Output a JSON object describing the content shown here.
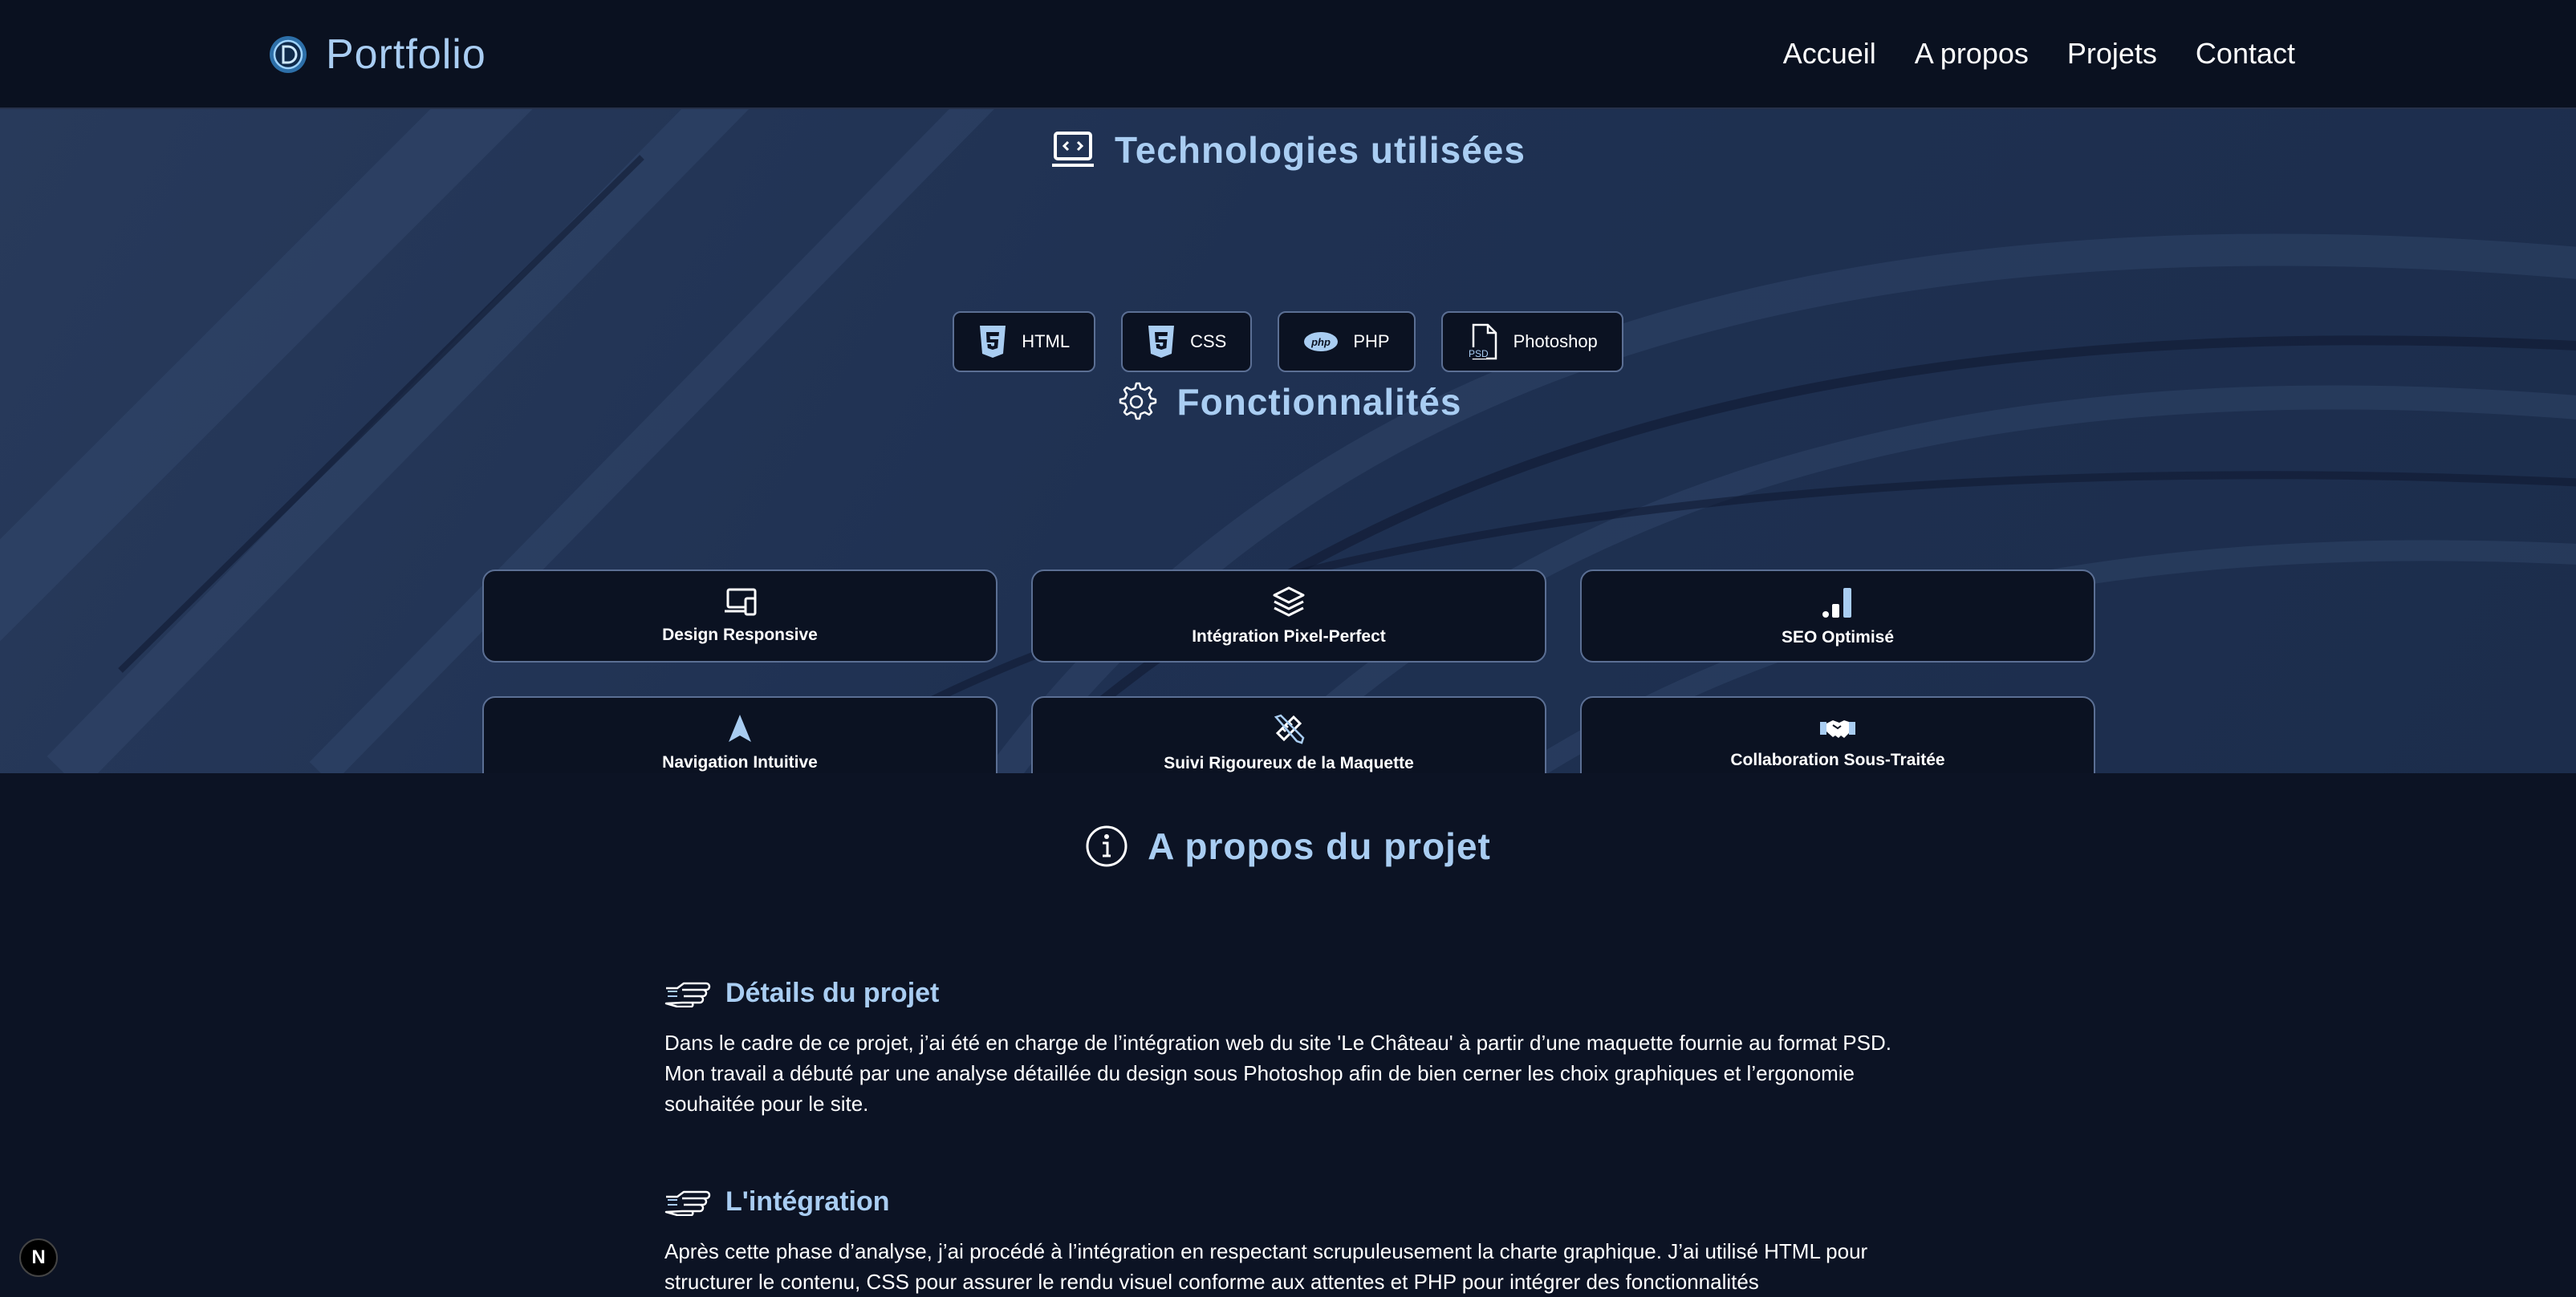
{
  "nav": {
    "brand": "Portfolio",
    "links": [
      "Accueil",
      "A propos",
      "Projets",
      "Contact"
    ]
  },
  "technologies": {
    "title": "Technologies utilisées",
    "items": [
      {
        "label": "HTML",
        "icon": "html5-icon"
      },
      {
        "label": "CSS",
        "icon": "css3-icon"
      },
      {
        "label": "PHP",
        "icon": "php-icon"
      },
      {
        "label": "Photoshop",
        "icon": "psd-file-icon"
      }
    ]
  },
  "features": {
    "title": "Fonctionnalités",
    "items": [
      {
        "label": "Design Responsive",
        "icon": "devices-icon"
      },
      {
        "label": "Intégration Pixel-Perfect",
        "icon": "layers-icon"
      },
      {
        "label": "SEO Optimisé",
        "icon": "signal-bars-icon"
      },
      {
        "label": "Navigation Intuitive",
        "icon": "navigation-arrow-icon"
      },
      {
        "label": "Suivi Rigoureux de la Maquette",
        "icon": "ruler-pencil-icon"
      },
      {
        "label": "Collaboration Sous-Traitée",
        "icon": "handshake-icon"
      }
    ]
  },
  "about": {
    "title": "A propos du projet",
    "sections": [
      {
        "heading": "Détails du projet",
        "text": "Dans le cadre de ce projet, j’ai été en charge de l’intégration web du site 'Le Château' à partir d’une maquette fournie au format PSD. Mon travail a débuté par une analyse détaillée du design sous Photoshop afin de bien cerner les choix graphiques et l’ergonomie souhaitée pour le site."
      },
      {
        "heading": "L'intégration",
        "text": "Après cette phase d’analyse, j’ai procédé à l’intégration en respectant scrupuleusement la charte graphique. J’ai utilisé HTML pour structurer le contenu, CSS pour assurer le rendu visuel conforme aux attentes et PHP pour intégrer des fonctionnalités"
      }
    ]
  },
  "badge": "N",
  "colors": {
    "accent": "#a9cdf2",
    "background": "#0c1324",
    "card": "#0b1222",
    "border": "#5b6f94"
  }
}
